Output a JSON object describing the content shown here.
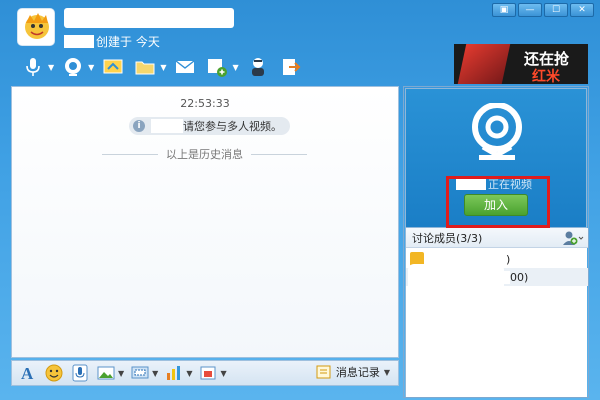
{
  "window": {
    "buttons": [
      "▣",
      "—",
      "☐",
      "✕"
    ]
  },
  "header": {
    "created_text": "创建于 今天"
  },
  "toolbar": {
    "items": [
      "mic-icon",
      "webcam-icon",
      "screen-share-icon",
      "file-transfer-icon",
      "email-icon",
      "app-icon",
      "remote-assist-icon",
      "exit-icon"
    ]
  },
  "ad": {
    "line1": "还在抢",
    "line2": "红米"
  },
  "chat": {
    "timestamp": "22:53:33",
    "invite_text": "请您参与多人视频。",
    "history_divider": "以上是历史消息"
  },
  "bottom_toolbar": {
    "history_label": "消息记录"
  },
  "video": {
    "status_text": "正在视频",
    "join_label": "加入"
  },
  "members": {
    "header": "讨论成员(3/3)",
    "rows": [
      ")",
      "00)"
    ]
  },
  "colors": {
    "accent": "#2f8fd6",
    "join_green": "#4aa12f",
    "highlight_red": "#e01c1c"
  }
}
